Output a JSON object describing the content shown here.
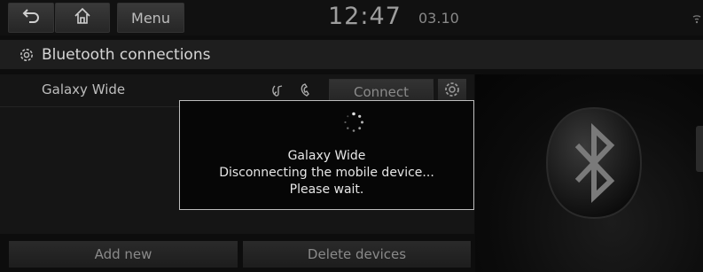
{
  "topbar": {
    "back_icon": "back-arrow-icon",
    "home_icon": "home-icon",
    "menu_label": "Menu",
    "time": "12:47",
    "date": "03.10",
    "status_icon": "wifi-icon"
  },
  "header": {
    "icon": "gear-icon",
    "title": "Bluetooth connections"
  },
  "devices": [
    {
      "name": "Galaxy Wide",
      "icons": [
        "bluetooth-audio-icon",
        "phone-icon"
      ],
      "action_label": "Connect",
      "settings_icon": "gear-icon"
    }
  ],
  "buttons": {
    "add_new": "Add new",
    "delete_devices": "Delete devices"
  },
  "dialog": {
    "icon": "loading-spinner-icon",
    "device": "Galaxy Wide",
    "message": "Disconnecting the mobile device...",
    "wait": "Please wait."
  },
  "background_icon": "bluetooth-logo-icon",
  "colors": {
    "background": "#0d0d0d",
    "button": "#2a2a2a",
    "dialog_border": "#bdbdbd",
    "text": "#d8d8d8"
  }
}
